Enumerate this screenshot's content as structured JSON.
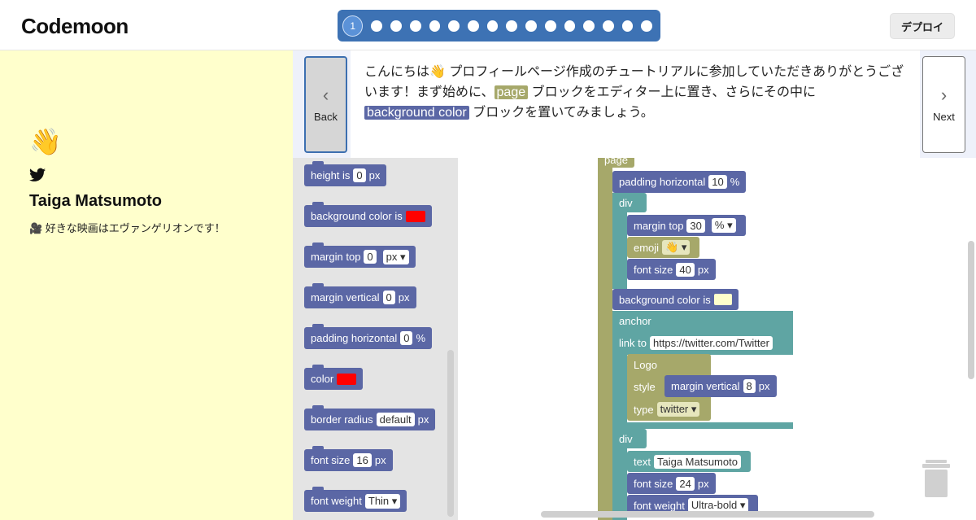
{
  "app": {
    "logo": "Codemoon",
    "deploy_label": "デプロイ"
  },
  "stepper": {
    "active_label": "1",
    "total_steps": 16
  },
  "preview": {
    "emoji": "👋",
    "name": "Taiga Matsumoto",
    "description": "🎥 好きな映画はエヴァンゲリオンです！"
  },
  "tutorial": {
    "back_label": "Back",
    "next_label": "Next",
    "text_1": "こんにちは👋 プロフィールページ作成のチュートリアルに参加していただきありがとうございます！まず始めに、",
    "hl_page": "page",
    "text_2": " ブロックをエディター上に置き、さらにその中に",
    "hl_bg": "background color",
    "text_3": " ブロックを置いてみましょう。"
  },
  "toolbox": {
    "height": {
      "label": "height is",
      "value": "0",
      "unit": "px"
    },
    "background_color": {
      "label": "background color is",
      "color": "#ff0000"
    },
    "margin_top": {
      "label": "margin top",
      "value": "0",
      "unit": "px"
    },
    "margin_vertical": {
      "label": "margin vertical",
      "value": "0",
      "unit": "px"
    },
    "padding_horizontal": {
      "label": "padding horizontal",
      "value": "0",
      "unit": "%"
    },
    "color": {
      "label": "color",
      "color": "#ff0000"
    },
    "border_radius": {
      "label": "border radius",
      "value": "default",
      "unit": "px"
    },
    "font_size": {
      "label": "font size",
      "value": "16",
      "unit": "px"
    },
    "font_weight": {
      "label": "font weight",
      "value": "Thin"
    }
  },
  "workspace": {
    "page_label": "page",
    "padding_h": {
      "label": "padding horizontal",
      "value": "10",
      "unit": "%"
    },
    "div1_label": "div",
    "margin_top": {
      "label": "margin top",
      "value": "30",
      "unit": "%"
    },
    "emoji": {
      "label": "emoji",
      "value": "👋"
    },
    "font_size_1": {
      "label": "font size",
      "value": "40",
      "unit": "px"
    },
    "bg_color": {
      "label": "background color is",
      "color": "#ffffcc"
    },
    "anchor_label": "anchor",
    "link": {
      "label": "link to",
      "value": "https://twitter.com/Twitter"
    },
    "logo_label": "Logo",
    "style_label": "style",
    "margin_vertical": {
      "label": "margin vertical",
      "value": "8",
      "unit": "px"
    },
    "type": {
      "label": "type",
      "value": "twitter"
    },
    "div2_label": "div",
    "text": {
      "label": "text",
      "value": "Taiga Matsumoto"
    },
    "font_size_2": {
      "label": "font size",
      "value": "24",
      "unit": "px"
    },
    "font_weight": {
      "label": "font weight",
      "value": "Ultra-bold"
    }
  },
  "colors": {
    "block_blue": "#5b67a5",
    "block_olive": "#a6a86a",
    "block_teal": "#5fa5a3",
    "stepper_blue": "#3d72b4",
    "preview_bg": "#ffffcc"
  }
}
